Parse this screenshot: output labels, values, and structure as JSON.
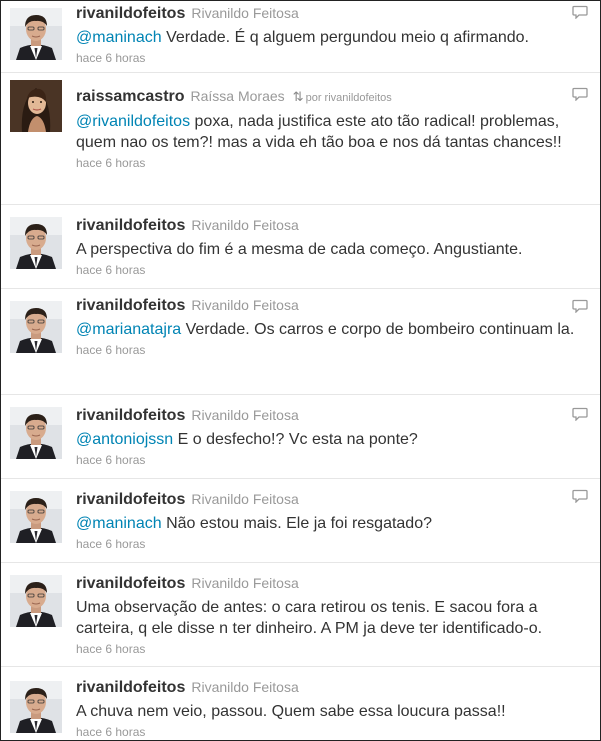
{
  "tweets": [
    {
      "screen_name": "rivanildofeitos",
      "full_name": "Rivanildo Feitosa",
      "retweet": "",
      "mention": "@maninach",
      "text": " Verdade. É q alguem pergundou meio q afirmando.",
      "time": "hace 6 horas",
      "avatar": "man-avatar",
      "reply": true
    },
    {
      "screen_name": "raissamcastro",
      "full_name": "Raíssa Moraes",
      "retweet": "por rivanildofeitos",
      "mention": "@rivanildofeitos",
      "text": " poxa, nada justifica este ato tão radical! problemas, quem nao os tem?! mas a vida eh tão boa e nos dá tantas chances!!",
      "time": "hace 6 horas",
      "avatar": "woman-avatar",
      "reply": true
    },
    {
      "screen_name": "rivanildofeitos",
      "full_name": "Rivanildo Feitosa",
      "retweet": "",
      "mention": "",
      "text": "A perspectiva do fim é a mesma de cada começo. Angustiante.",
      "time": "hace 6 horas",
      "avatar": "man-avatar",
      "reply": false
    },
    {
      "screen_name": "rivanildofeitos",
      "full_name": "Rivanildo Feitosa",
      "retweet": "",
      "mention": "@marianatajra",
      "text": " Verdade. Os carros e corpo de bombeiro continuam la.",
      "time": "hace 6 horas",
      "avatar": "man-avatar",
      "reply": true
    },
    {
      "screen_name": "rivanildofeitos",
      "full_name": "Rivanildo Feitosa",
      "retweet": "",
      "mention": "@antoniojssn",
      "text": " E o desfecho!? Vc esta na ponte?",
      "time": "hace 6 horas",
      "avatar": "man-avatar",
      "reply": true
    },
    {
      "screen_name": "rivanildofeitos",
      "full_name": "Rivanildo Feitosa",
      "retweet": "",
      "mention": "@maninach",
      "text": " Não estou mais. Ele ja foi resgatado?",
      "time": "hace 6 horas",
      "avatar": "man-avatar",
      "reply": true
    },
    {
      "screen_name": "rivanildofeitos",
      "full_name": "Rivanildo Feitosa",
      "retweet": "",
      "mention": "",
      "text": "Uma observação de antes: o cara retirou os tenis. E sacou fora a carteira, q ele disse n ter dinheiro. A PM ja deve ter identificado-o.",
      "time": "hace 6 horas",
      "avatar": "man-avatar",
      "reply": false
    },
    {
      "screen_name": "rivanildofeitos",
      "full_name": "Rivanildo Feitosa",
      "retweet": "",
      "mention": "",
      "text": "A chuva nem veio, passou. Quem sabe essa loucura passa!!",
      "time": "hace 6 horas",
      "avatar": "man-avatar",
      "reply": false
    }
  ]
}
